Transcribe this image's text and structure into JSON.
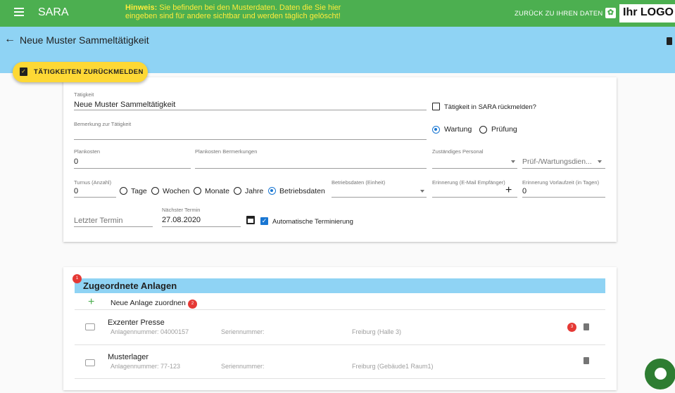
{
  "topbar": {
    "app_name": "SARA",
    "hint_bold": "Hinweis:",
    "hint_text": " Sie befinden bei den Musterdaten. Daten die Sie hier eingeben sind für andere sichtbar und werden täglich gelöscht!",
    "back_link": "ZURÜCK ZU IHREN DATEN",
    "logo": "Ihr LOGO",
    "gear_icon": "gear-icon"
  },
  "header": {
    "title": "Neue Muster Sammeltätigkeit",
    "report_button": "TÄTIGKEITEN ZURÜCKMELDEN"
  },
  "form": {
    "taetigkeit_label": "Tätigkeit",
    "taetigkeit_value": "Neue Muster Sammeltätigkeit",
    "sara_report_label": "Tätigkeit in SARA rückmelden?",
    "sara_report_checked": false,
    "bemerkung_label": "Bemerkung zur Tätigkeit",
    "bemerkung_value": "",
    "type_options": [
      "Wartung",
      "Prüfung"
    ],
    "type_selected": "Wartung",
    "plankosten_label": "Plankosten",
    "plankosten_value": "0",
    "plankosten_bem_label": "Plankosten Bermerkungen",
    "personal_label": "Zuständiges Personal",
    "dienstleister_placeholder": "Prüf-/Wartungsdien...",
    "turnus_label": "Turnus (Anzahl)",
    "turnus_value": "0",
    "turnus_units": [
      "Tage",
      "Wochen",
      "Monate",
      "Jahre",
      "Betriebsdaten"
    ],
    "turnus_selected": "Betriebsdaten",
    "betriebsdaten_label": "Betriebsdaten (Einheit)",
    "erinnerung_label": "Erinnerung (E-Mail Empfänger)",
    "vorlaufzeit_label": "Erinnerung Vorlaufzeit (in Tagen)",
    "vorlaufzeit_value": "0",
    "letzter_termin_placeholder": "Letzter Termin",
    "naechster_termin_label": "Nächster Termin",
    "naechster_termin_value": "27.08.2020",
    "auto_termin_label": "Automatische Terminierung",
    "auto_termin_checked": true
  },
  "assets": {
    "section_title": "Zugeordnete Anlagen",
    "add_label": "Neue Anlage zuordnen",
    "badges": [
      "1",
      "2",
      "3"
    ],
    "items": [
      {
        "name": "Exzenter Presse",
        "nummer": "Anlagennummer: 04000157",
        "serien": "Seriennummer:",
        "ort": "Freiburg (Halle 3)"
      },
      {
        "name": "Musterlager",
        "nummer": "Anlagennummer: 77-123",
        "serien": "Seriennummer:",
        "ort": "Freiburg (Gebäude1 Raum1)"
      }
    ]
  },
  "colors": {
    "topbar": "#4caf50",
    "subheader": "#8fd3f4",
    "accent": "#1976d2",
    "report_button": "#fdd835",
    "badge": "#e53935"
  }
}
